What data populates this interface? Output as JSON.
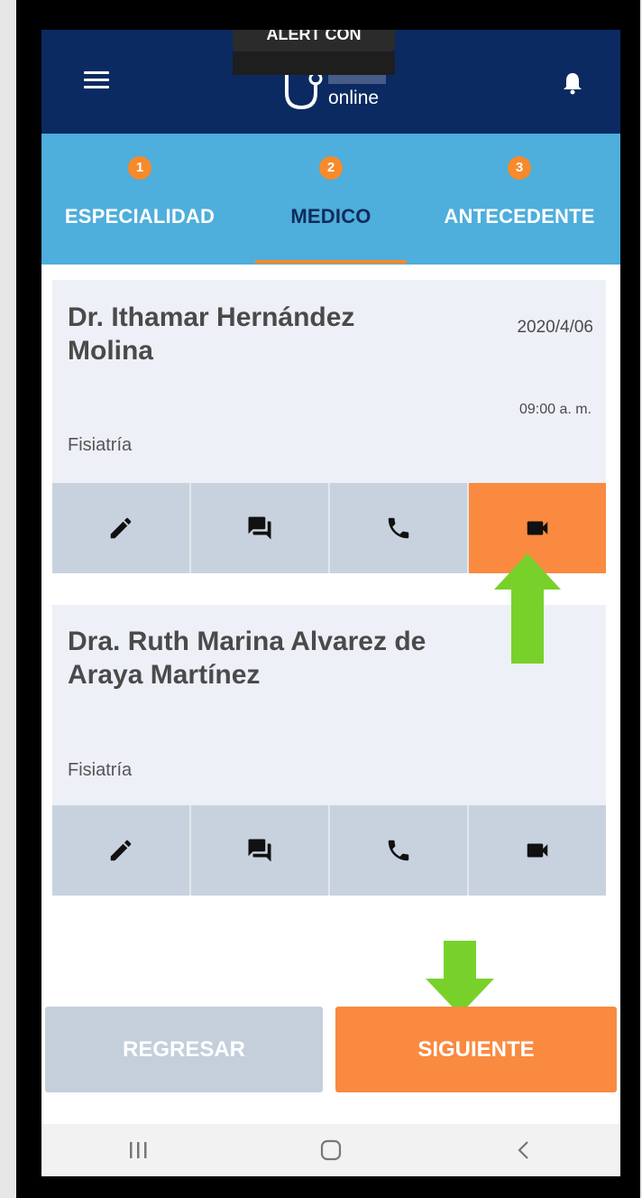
{
  "toast": {
    "text": "ALERT CON"
  },
  "header": {
    "logo_text": "online",
    "menu_icon": "menu-icon",
    "notification_icon": "bell-icon"
  },
  "steps": [
    {
      "number": "1",
      "label": "ESPECIALIDAD"
    },
    {
      "number": "2",
      "label": "MEDICO"
    },
    {
      "number": "3",
      "label": "ANTECEDENTE"
    }
  ],
  "active_step_index": 1,
  "doctors": [
    {
      "name_line1": "Dr. Ithamar Hernández",
      "name_line2": "Molina",
      "date": "2020/4/06",
      "time": "09:00 a. m.",
      "specialty": "Fisiatría",
      "selected_action": "video"
    },
    {
      "name_line1": "Dra. Ruth Marina Alvarez de",
      "name_line2": "Araya Martínez",
      "date": "",
      "time": "",
      "specialty": "Fisiatría",
      "selected_action": ""
    }
  ],
  "actions": [
    "edit-icon",
    "chat-icon",
    "phone-icon",
    "video-icon"
  ],
  "buttons": {
    "back_label": "REGRESAR",
    "next_label": "SIGUIENTE"
  },
  "colors": {
    "header": "#0b2a61",
    "steps_bar": "#4eaedc",
    "accent": "#f98a40",
    "action_bg": "#c8d2de",
    "arrow": "#78d12a"
  }
}
